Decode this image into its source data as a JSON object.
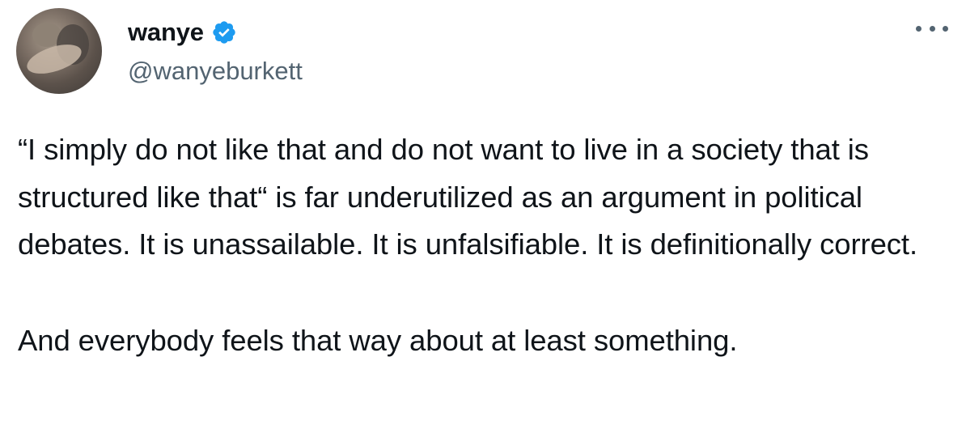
{
  "author": {
    "display_name": "wanye",
    "handle": "@wanyeburkett",
    "verified": true,
    "verified_color": "#1d9bf0"
  },
  "menu": {
    "icon": "more-horizontal-icon"
  },
  "post": {
    "paragraph_1": "“I simply do not like that and do not want to live in a society that is structured like that“ is far underutilized as an argument in political debates. It is unassailable. It is unfalsifiable. It is definitionally correct.",
    "paragraph_2": "And everybody feels that way about at least something."
  }
}
